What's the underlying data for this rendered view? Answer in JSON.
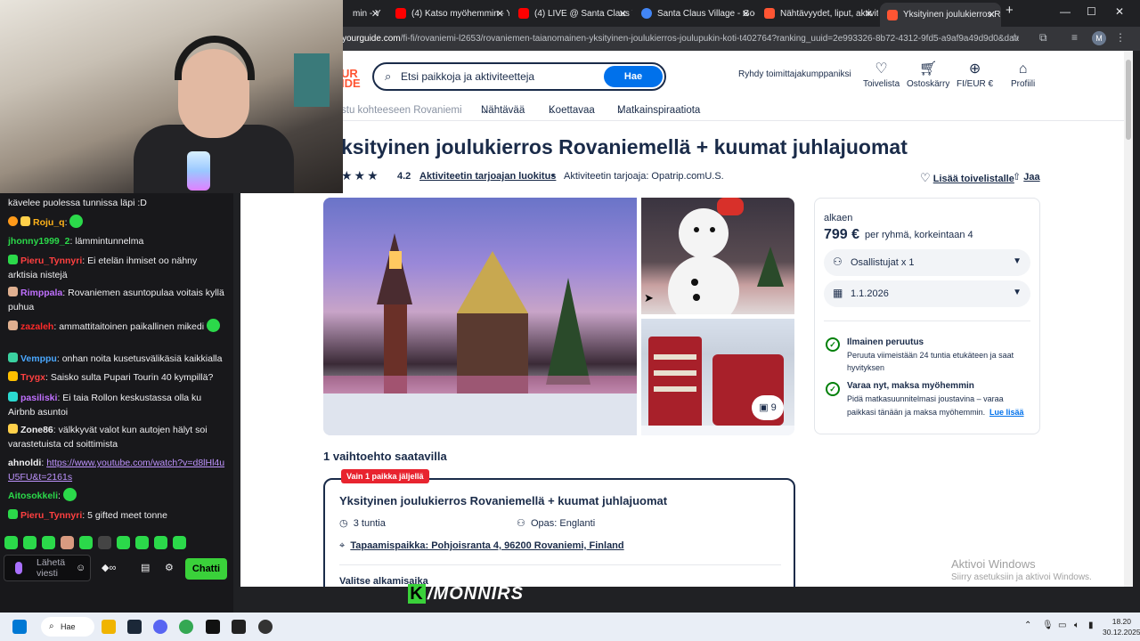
{
  "browser": {
    "tabs": [
      {
        "label": "min - Y"
      },
      {
        "label": "(4) Katso myöhemmin - Y"
      },
      {
        "label": "(4) LIVE @ Santa Claus Vi"
      },
      {
        "label": "Santa Claus Village - Goo"
      },
      {
        "label": "Nähtävyydet, liput, aktivit"
      },
      {
        "label": "Yksityinen joulukierros Ro"
      }
    ],
    "url_host": "yourguide.com",
    "url_rest": "/fi-fi/rovaniemi-l2653/rovaniemen-taianomainen-yksityinen-joulukierros-joulupukin-koti-t402764?ranking_uuid=2e993326-8b72-4312-9fd5-a9af9a49d9d0&date_",
    "profile_letter": "M"
  },
  "header": {
    "logo": "UR\nIDE",
    "search_placeholder": "Etsi paikkoja ja aktiviteetteja",
    "search_button": "Hae",
    "partner": "Ryhdy toimittajakumppaniksi",
    "nav": [
      {
        "label": "Toivelista",
        "icon": "heart-icon"
      },
      {
        "label": "Ostoskärry",
        "icon": "cart-icon"
      },
      {
        "label": "FI/EUR €",
        "icon": "globe-icon"
      },
      {
        "label": "Profiili",
        "icon": "profile-icon"
      }
    ]
  },
  "subnav": {
    "muted": "stu kohteeseen Rovaniemi",
    "items": [
      "Nähtävää",
      "Koettavaa",
      "Matkainspiraatiota"
    ]
  },
  "activity": {
    "title": "ksityinen joulukierros Rovaniemellä + kuumat juhlajuomat",
    "rating": "4.2",
    "rating_link": "Aktiviteetin tarjoajan luokitus",
    "provider": "Aktiviteetin tarjoaja: Opatrip.comU.S.",
    "wishlist": "Lisää toivelistalle",
    "share": "Jaa",
    "photo_count": "9",
    "available": "1 vaihtoehto saatavilla",
    "option": {
      "tag": "Vain 1 paikka jäljellä",
      "title": "Yksityinen joulukierros Rovaniemellä + kuumat juhlajuomat",
      "duration": "3 tuntia",
      "guide": "Opas: Englanti",
      "meeting": "Tapaamispaikka: Pohjoisranta 4, 96200 Rovaniemi, Finland",
      "start_label": "Valitse alkamisaika"
    }
  },
  "price": {
    "from": "alkaen",
    "amount": "799 €",
    "per": "per ryhmä, korkeintaan 4",
    "participants": "Osallistujat x 1",
    "date": "1.1.2026",
    "cancel_title": "Ilmainen peruutus",
    "cancel_text1": "Peruuta viimeistään 24 tuntia etukäteen ja saat",
    "cancel_text2": "hyvityksen",
    "reserve_title": "Varaa nyt, maksa myöhemmin",
    "reserve_text1": "Pidä matkasuunnitelmasi joustavina – varaa",
    "reserve_text2": "paikkasi tänään ja maksa myöhemmin.",
    "reserve_link": "Lue lisää"
  },
  "windows": {
    "activate_title": "Aktivoi Windows",
    "activate_sub": "Siirry asetuksiin ja aktivoi Windows.",
    "search": "Hae",
    "time": "18.20",
    "date": "30.12.2025"
  },
  "chat": {
    "messages": [
      {
        "user": "",
        "text": "kävelee puolessa tunnissa läpi :D",
        "color": "#efeff1"
      },
      {
        "user": "Roju_q",
        "text": "",
        "color": "#ffb31a"
      },
      {
        "user": "jhonny1999_2",
        "text": "lämmintunnelma",
        "color": "#2bd94a"
      },
      {
        "user": "Pieru_Tynnyri",
        "text": "Ei etelän ihmiset oo nähny arktisia nistejä",
        "color": "#ff4040"
      },
      {
        "user": "Rimppala",
        "text": "Rovaniemen asuntopulaa voitais kyllä puhua",
        "color": "#c070ff"
      },
      {
        "user": "zazaleh",
        "text": "ammattitaitoinen paikallinen mikedi",
        "color": "#ff2a2a"
      },
      {
        "user": "Vemppu",
        "text": "onhan noita kusetusvälikäsiä kaikkialla",
        "color": "#4aa8ff"
      },
      {
        "user": "Trygx",
        "text": "Saisko sulta Pupari Tourin 40 kympillä?",
        "color": "#ff4040"
      },
      {
        "user": "pasiliski",
        "text": "Ei taia Rollon keskustassa olla ku Airbnb asuntoi",
        "color": "#c070ff"
      },
      {
        "user": "Zone86",
        "text": "välkkyvät valot kun autojen hälyt soi varastetuista cd soittimista",
        "color": "#efeff1"
      },
      {
        "user": "ahnoldi",
        "text": "https://www.youtube.com/watch?v=d8lHl4uU5FU&t=2161s",
        "color": "#efeff1"
      },
      {
        "user": "Aitosokkeli",
        "text": "",
        "color": "#2bd94a"
      },
      {
        "user": "Pieru_Tynnyri",
        "text": "5 gifted meet tonne",
        "color": "#ff4040"
      }
    ],
    "send_placeholder": "Lähetä viesti",
    "chat_button": "Chatti"
  },
  "stream_logo": "/MONNIRS"
}
